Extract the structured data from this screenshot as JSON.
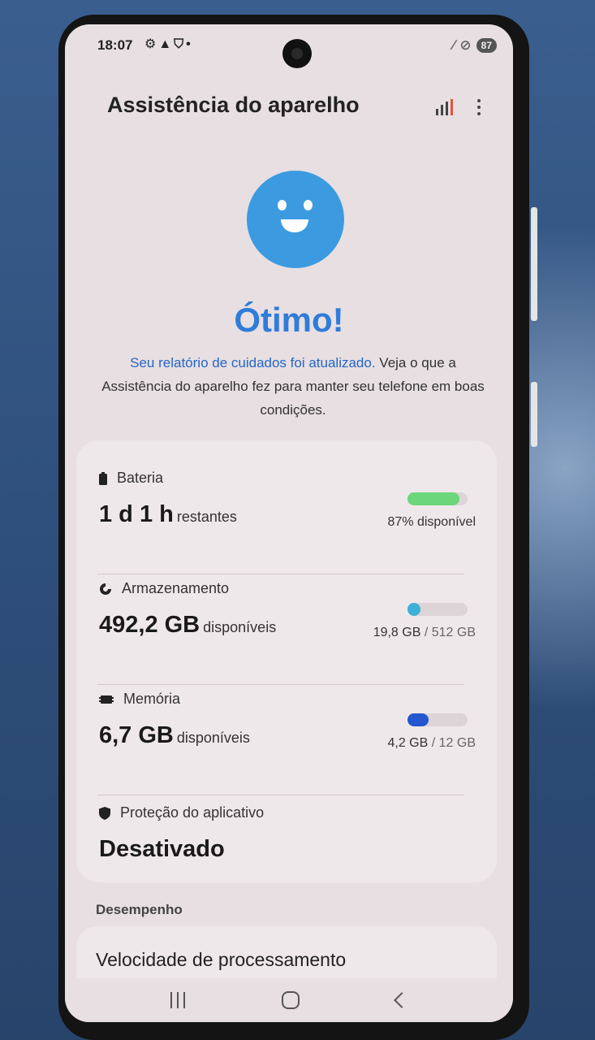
{
  "status_bar": {
    "time": "18:07",
    "left_icons": "⚙▲⛉•",
    "battery": "87"
  },
  "app_bar": {
    "title": "Assistência do aparelho"
  },
  "hero": {
    "headline": "Ótimo!",
    "link_text": "Seu relatório de cuidados foi atualizado.",
    "description_rest": " Veja o que a Assistência do aparelho fez para manter seu telefone em boas condições."
  },
  "battery": {
    "label": "Bateria",
    "value": "1 d 1 h",
    "value_unit": "restantes",
    "right_text": "87% disponível",
    "fill_fraction": 0.87,
    "color": "#6cd67a"
  },
  "storage": {
    "label": "Armazenamento",
    "value": "492,2 GB",
    "value_unit": "disponíveis",
    "used": "19,8 GB",
    "separator": " / ",
    "total": "512 GB",
    "fill_fraction": 0.04,
    "color": "#3db0d6"
  },
  "memory": {
    "label": "Memória",
    "value": "6,7 GB",
    "value_unit": "disponíveis",
    "used": "4,2 GB",
    "separator": " / ",
    "total": "12 GB",
    "fill_fraction": 0.35,
    "color": "#2457cf"
  },
  "app_protection": {
    "label": "Proteção do aplicativo",
    "value": "Desativado"
  },
  "performance": {
    "section_label": "Desempenho",
    "item": "Velocidade de processamento"
  }
}
